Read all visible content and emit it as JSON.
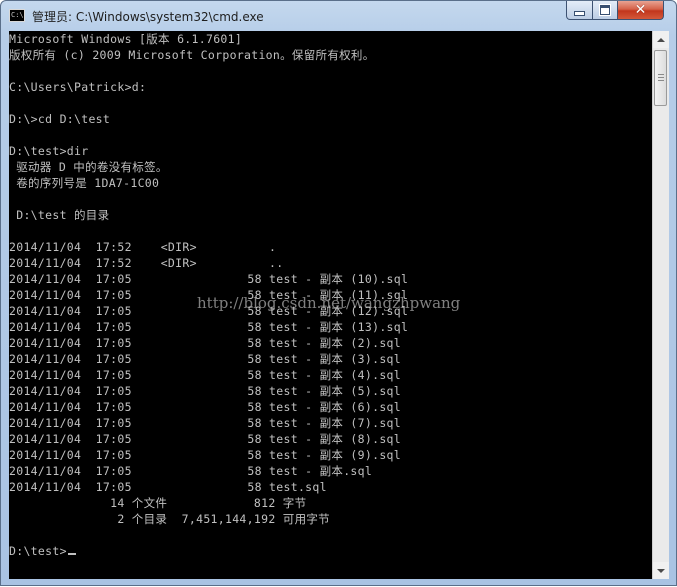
{
  "window": {
    "title": "管理员: C:\\Windows\\system32\\cmd.exe",
    "app_icon_text": "C:\\",
    "buttons": {
      "minimize": "–",
      "maximize": "□",
      "close": "✕"
    },
    "colors": {
      "console_bg": "#000000",
      "console_fg": "#c0c0c0",
      "frame": "#a9c3e3",
      "close": "#c2361c"
    }
  },
  "console": {
    "lines": [
      "Microsoft Windows [版本 6.1.7601]",
      "版权所有 (c) 2009 Microsoft Corporation。保留所有权利。",
      "",
      "C:\\Users\\Patrick>d:",
      "",
      "D:\\>cd D:\\test",
      "",
      "D:\\test>dir",
      " 驱动器 D 中的卷没有标签。",
      " 卷的序列号是 1DA7-1C00",
      "",
      " D:\\test 的目录",
      "",
      "2014/11/04  17:52    <DIR>          .",
      "2014/11/04  17:52    <DIR>          ..",
      "2014/11/04  17:05                58 test - 副本 (10).sql",
      "2014/11/04  17:05                58 test - 副本 (11).sql",
      "2014/11/04  17:05                58 test - 副本 (12).sql",
      "2014/11/04  17:05                58 test - 副本 (13).sql",
      "2014/11/04  17:05                58 test - 副本 (2).sql",
      "2014/11/04  17:05                58 test - 副本 (3).sql",
      "2014/11/04  17:05                58 test - 副本 (4).sql",
      "2014/11/04  17:05                58 test - 副本 (5).sql",
      "2014/11/04  17:05                58 test - 副本 (6).sql",
      "2014/11/04  17:05                58 test - 副本 (7).sql",
      "2014/11/04  17:05                58 test - 副本 (8).sql",
      "2014/11/04  17:05                58 test - 副本 (9).sql",
      "2014/11/04  17:05                58 test - 副本.sql",
      "2014/11/04  17:05                58 test.sql",
      "              14 个文件            812 字节",
      "               2 个目录  7,451,144,192 可用字节",
      "",
      "D:\\test>"
    ],
    "watermark": "http://blog.csdn.net/wangzhpwang"
  },
  "scrollbar": {
    "position": 0.0
  }
}
